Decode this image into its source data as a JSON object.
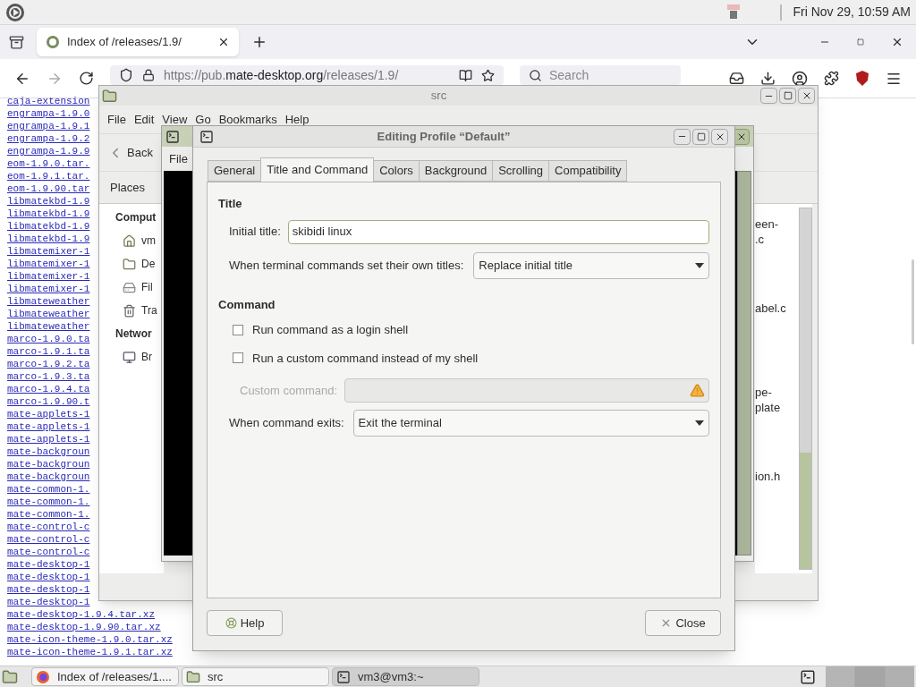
{
  "top_panel": {
    "clock": "Fri Nov 29, 10:59 AM"
  },
  "browser": {
    "tabs": [
      {
        "label": "Index of /releases/1.9/",
        "selected": true
      }
    ],
    "url": {
      "prefix": "https://pub.",
      "domain": "mate-desktop.org",
      "path": "/releases/1.9/"
    },
    "search": {
      "placeholder": "Search"
    },
    "links": [
      "caja-extension",
      "engrampa-1.9.0",
      "engrampa-1.9.1",
      "engrampa-1.9.2",
      "engrampa-1.9.9",
      "eom-1.9.0.tar.",
      "eom-1.9.1.tar.",
      "eom-1.9.90.tar",
      "libmatekbd-1.9",
      "libmatekbd-1.9",
      "libmatekbd-1.9",
      "libmatekbd-1.9",
      "libmatemixer-1",
      "libmatemixer-1",
      "libmatemixer-1",
      "libmatemixer-1",
      "libmateweather",
      "libmateweather",
      "libmateweather",
      "marco-1.9.0.ta",
      "marco-1.9.1.ta",
      "marco-1.9.2.ta",
      "marco-1.9.3.ta",
      "marco-1.9.4.ta",
      "marco-1.9.90.t",
      "mate-applets-1",
      "mate-applets-1",
      "mate-applets-1",
      "mate-backgroun",
      "mate-backgroun",
      "mate-backgroun",
      "mate-common-1.",
      "mate-common-1.",
      "mate-common-1.",
      "mate-control-c",
      "mate-control-c",
      "mate-control-c",
      "mate-desktop-1",
      "mate-desktop-1",
      "mate-desktop-1",
      "mate-desktop-1",
      "mate-desktop-1.9.4.tar.xz",
      "mate-desktop-1.9.90.tar.xz",
      "mate-icon-theme-1.9.0.tar.xz",
      "mate-icon-theme-1.9.1.tar.xz"
    ]
  },
  "file_manager": {
    "title": "src",
    "menu": [
      "File",
      "Edit",
      "View",
      "Go",
      "Bookmarks",
      "Help"
    ],
    "back": "Back",
    "places": "Places",
    "sidebar": [
      {
        "kind": "heading",
        "label": "Comput"
      },
      {
        "kind": "home",
        "label": "vm"
      },
      {
        "kind": "desktop",
        "label": "De"
      },
      {
        "kind": "drive",
        "label": "Fil"
      },
      {
        "kind": "trash",
        "label": "Tra"
      },
      {
        "kind": "heading",
        "label": "Networ"
      },
      {
        "kind": "network",
        "label": "Br"
      }
    ],
    "files": [
      {
        "lines": [
          "een-",
          ".c"
        ]
      },
      {
        "lines": [
          "abel.c"
        ]
      },
      {
        "lines": [
          "pe-",
          "plate"
        ]
      },
      {
        "lines": [
          "ion.h"
        ]
      }
    ]
  },
  "terminal": {
    "menu": [
      "File"
    ]
  },
  "dialog": {
    "title": "Editing Profile “Default”",
    "tabs": [
      {
        "label": "General",
        "selected": false
      },
      {
        "label": "Title and Command",
        "selected": true
      },
      {
        "label": "Colors",
        "selected": false
      },
      {
        "label": "Background",
        "selected": false
      },
      {
        "label": "Scrolling",
        "selected": false
      },
      {
        "label": "Compatibility",
        "selected": false
      }
    ],
    "title_heading": "Title",
    "initial_title": {
      "label": "Initial title:",
      "value": "skibidi linux"
    },
    "dynamic_title": {
      "label": "When terminal commands set their own titles:",
      "value": "Replace initial title"
    },
    "command_heading": "Command",
    "checkboxes": [
      {
        "label": "Run command as a login shell",
        "checked": false
      },
      {
        "label": "Run a custom command instead of my shell",
        "checked": false
      }
    ],
    "custom_command": {
      "label": "Custom command:",
      "disabled": true
    },
    "exit_action": {
      "label": "When command exits:",
      "value": "Exit the terminal"
    },
    "help": "Help",
    "close": "Close"
  },
  "taskbar": [
    {
      "kind": "browser",
      "label": "Index of /releases/1....",
      "selected": false
    },
    {
      "kind": "folder",
      "label": "src",
      "selected": false
    },
    {
      "kind": "terminal",
      "label": "vm3@vm3:~",
      "selected": true
    }
  ]
}
